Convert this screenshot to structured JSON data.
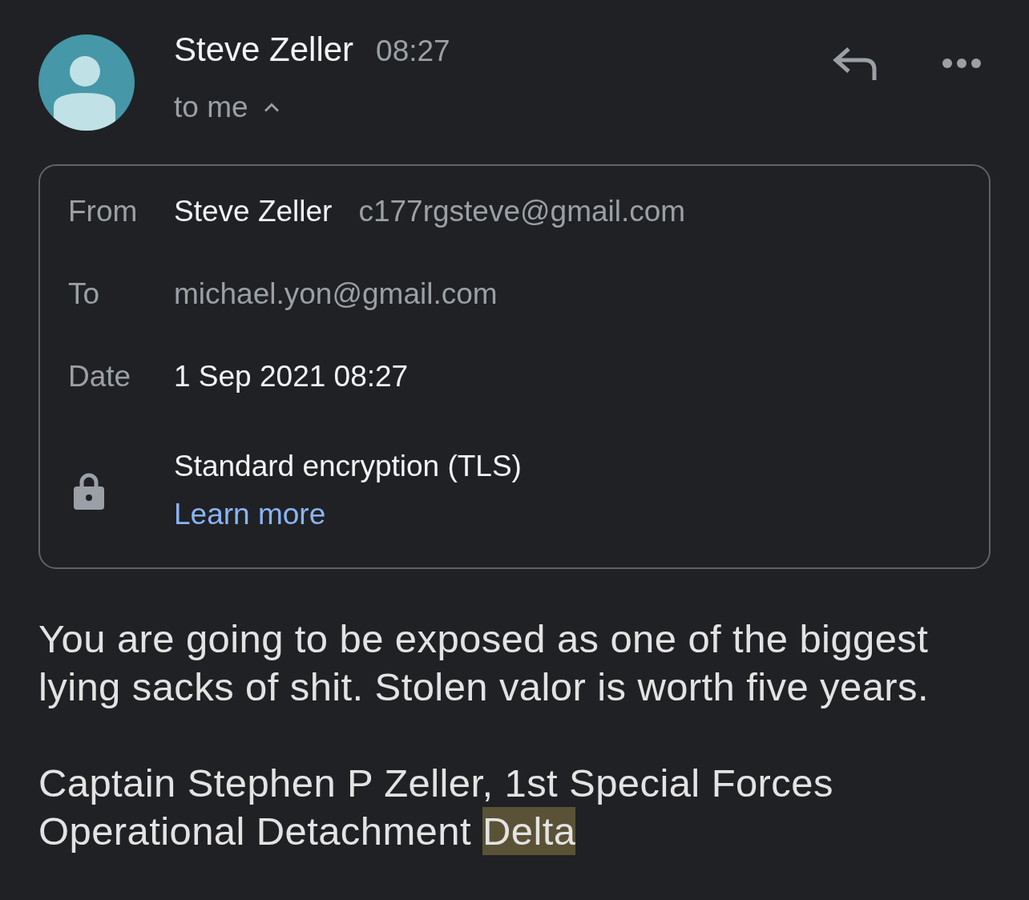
{
  "header": {
    "sender": "Steve Zeller",
    "time": "08:27",
    "recipients_label": "to me",
    "details_expanded": true
  },
  "details": {
    "rows": [
      {
        "kind": "person",
        "label": "From",
        "name": "Steve Zeller",
        "email": "c177rgsteve@gmail.com"
      },
      {
        "kind": "address",
        "label": "To",
        "value": "michael.yon@gmail.com"
      },
      {
        "kind": "text",
        "label": "Date",
        "value": "1 Sep 2021 08:27"
      }
    ],
    "security": {
      "title": "Standard encryption (TLS)",
      "link": "Learn more"
    }
  },
  "body": [
    {
      "segments": [
        {
          "text": "You are going to be exposed as one of the biggest lying sacks of shit. Stolen valor is worth five years.",
          "highlighted": false
        }
      ]
    },
    {
      "segments": [
        {
          "text": "Captain Stephen P Zeller, 1st Special Forces Operational Detachment ",
          "highlighted": false
        },
        {
          "text": "Delta",
          "highlighted": true
        }
      ]
    }
  ]
}
